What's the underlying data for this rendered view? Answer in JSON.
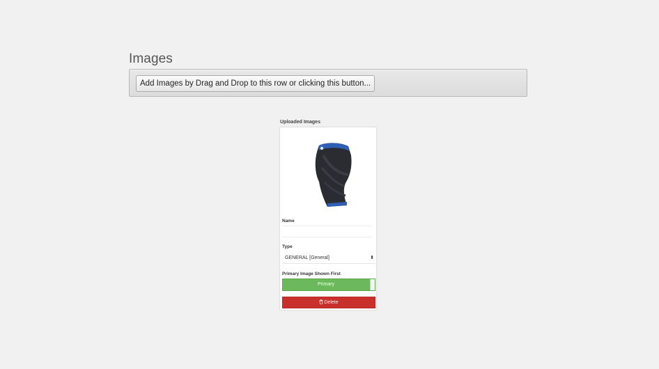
{
  "images_section": {
    "title": "Images",
    "add_button_label": "Add Images by Drag and Drop to this row or clicking this button..."
  },
  "uploaded": {
    "label": "Uploaded Images",
    "items": [
      {
        "thumbnail_icon": "knee-sleeve-image",
        "name_label": "Name",
        "name_value": "",
        "type_label": "Type",
        "type_value": "GENERAL [General]",
        "primary_label": "Primary Image Shown First",
        "primary_toggle_label": "Primary",
        "primary_on": true,
        "delete_label": "Delete",
        "delete_icon": "trash-icon"
      }
    ]
  },
  "colors": {
    "primary_green": "#6cb85c",
    "delete_red": "#c9302c",
    "page_background": "#f1f1f1"
  }
}
